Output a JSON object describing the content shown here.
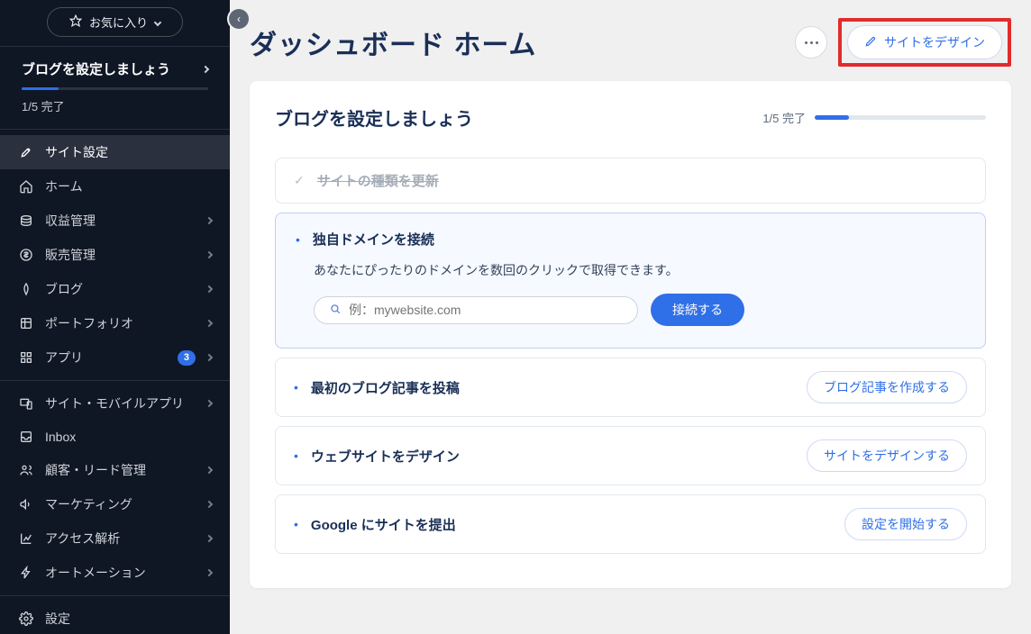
{
  "favorites_label": "お気に入り",
  "sidebar_setup": {
    "title": "ブログを設定しましょう",
    "progress_label": "1/5 完了",
    "progress_pct": 20
  },
  "sidebar_items": {
    "site_settings": "サイト設定",
    "home": "ホーム",
    "monetization": "収益管理",
    "sales": "販売管理",
    "blog": "ブログ",
    "portfolio": "ポートフォリオ",
    "apps": "アプリ",
    "apps_badge": "3",
    "site_mobile": "サイト・モバイルアプリ",
    "inbox": "Inbox",
    "customers": "顧客・リード管理",
    "marketing": "マーケティング",
    "analytics": "アクセス解析",
    "automation": "オートメーション",
    "settings": "設定"
  },
  "header": {
    "page_title": "ダッシュボード ホーム",
    "design_site_label": "サイトをデザイン"
  },
  "card": {
    "title": "ブログを設定しましょう",
    "progress_label": "1/5 完了",
    "progress_pct": 20
  },
  "steps": {
    "done": {
      "title": "サイトの種類を更新"
    },
    "domain": {
      "title": "独自ドメインを接続",
      "desc": "あなたにぴったりのドメインを数回のクリックで取得できます。",
      "placeholder": "例：mywebsite.com",
      "connect_label": "接続する"
    },
    "first_post": {
      "title": "最初のブログ記事を投稿",
      "action": "ブログ記事を作成する"
    },
    "design": {
      "title": "ウェブサイトをデザイン",
      "action": "サイトをデザインする"
    },
    "google": {
      "title": "Google にサイトを提出",
      "action": "設定を開始する"
    }
  }
}
